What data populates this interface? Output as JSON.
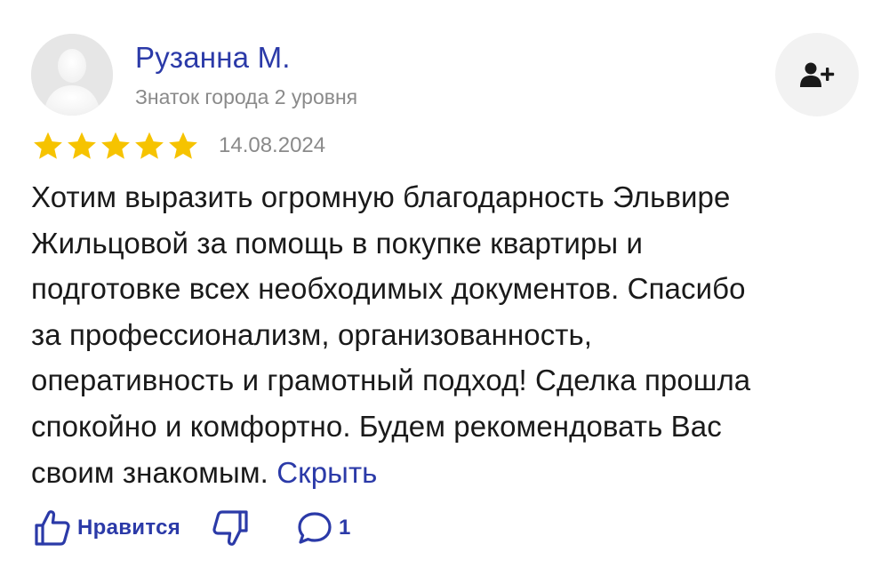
{
  "author": {
    "name": "Рузанна М.",
    "level": "Знаток города 2 уровня"
  },
  "review": {
    "rating": 5,
    "rating_max": 5,
    "date": "14.08.2024",
    "text_lines": [
      "Хотим выразить огромную благодарность Эльвире",
      "Жильцовой за помощь в покупке квартиры и",
      "подготовке всех необходимых документов. Спасибо",
      "за профессионализм, организованность,",
      "оперативность и грамотный подход! Сделка прошла",
      "спокойно и комфортно. Будем рекомендовать Вас",
      "своим знакомым."
    ],
    "hide_label": "Скрыть"
  },
  "actions": {
    "like_label": "Нравится",
    "comments_count": "1"
  },
  "colors": {
    "link": "#2b3aa8",
    "star": "#f6c300",
    "muted": "#8a8a8a"
  },
  "icons": {
    "avatar": "user-silhouette-icon",
    "subscribe": "add-user-icon",
    "star": "star-icon",
    "like": "thumb-up-icon",
    "dislike": "thumb-down-icon",
    "comment": "comment-icon"
  }
}
